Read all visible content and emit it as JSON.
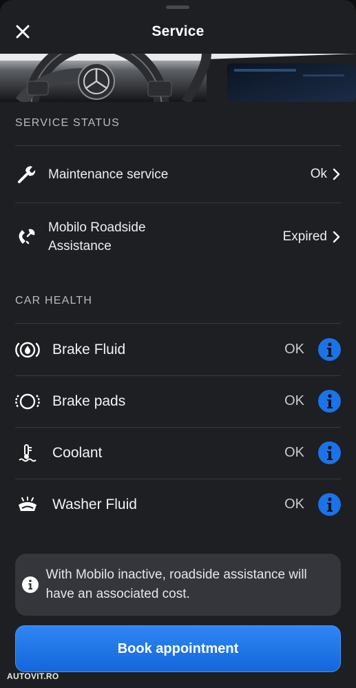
{
  "header": {
    "title": "Service"
  },
  "service_status": {
    "heading": "SERVICE STATUS",
    "items": [
      {
        "label": "Maintenance service",
        "value": "Ok",
        "icon": "wrench-icon"
      },
      {
        "label_lines": [
          "Mobilo Roadside",
          "Assistance"
        ],
        "value": "Expired",
        "icon": "roadside-phone-icon"
      }
    ]
  },
  "car_health": {
    "heading": "CAR HEALTH",
    "items": [
      {
        "label": "Brake Fluid",
        "status": "OK",
        "icon": "brake-fluid-icon"
      },
      {
        "label": "Brake pads",
        "status": "OK",
        "icon": "brake-pads-icon"
      },
      {
        "label": "Coolant",
        "status": "OK",
        "icon": "coolant-icon"
      },
      {
        "label": "Washer Fluid",
        "status": "OK",
        "icon": "washer-fluid-icon"
      }
    ]
  },
  "notice": {
    "text": "With Mobilo inactive, roadside assistance will have an associated cost.",
    "icon": "info-icon"
  },
  "book_button": {
    "label": "Book appointment"
  },
  "watermark": "AUTOVIT.RO",
  "colors": {
    "background": "#1e1f22",
    "accent": "#1a73e8",
    "card": "#34363b",
    "divider": "#3a3b3f"
  }
}
